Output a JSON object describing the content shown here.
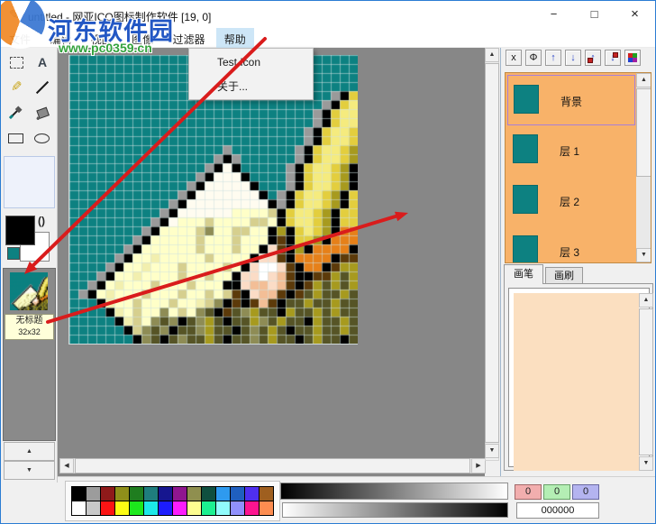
{
  "window": {
    "title": "untitled - 网亚ICO图标制作软件 [19, 0]",
    "controls": {
      "minimize": "−",
      "maximize": "□",
      "close": "×"
    }
  },
  "watermark": {
    "site_name": "河东软件园",
    "site_url": "www.pc0359.cn"
  },
  "menu": {
    "items": [
      {
        "label": "文件"
      },
      {
        "label": "编辑"
      },
      {
        "label": "视图"
      },
      {
        "label": "图像"
      },
      {
        "label": "过滤器"
      },
      {
        "label": "帮助"
      }
    ],
    "dropdown": {
      "items": [
        {
          "label": "Test Icon"
        },
        {
          "label": "关于..."
        }
      ]
    }
  },
  "toolbox": {
    "text_tool_label": "A",
    "swap_label": "()"
  },
  "icon_preview": {
    "name_label": "无标题",
    "size_label": "32x32"
  },
  "layers": {
    "toolbar": [
      {
        "glyph": "x"
      },
      {
        "glyph": "Φ"
      },
      {
        "glyph": "↑"
      },
      {
        "glyph": "↓"
      },
      {
        "glyph": "↑"
      },
      {
        "glyph": "↓"
      },
      {
        "glyph": ""
      }
    ],
    "items": [
      {
        "label": "背景",
        "selected": true
      },
      {
        "label": "层 1"
      },
      {
        "label": "层 2"
      },
      {
        "label": "层 3"
      }
    ],
    "swatch_color": "#0d8181"
  },
  "brush_panel": {
    "tabs": [
      {
        "label": "画笔"
      },
      {
        "label": "画刷"
      }
    ]
  },
  "color_bar": {
    "r": "0",
    "g": "0",
    "b": "0",
    "hex": "000000",
    "palette_row1": [
      "#000000",
      "#9c9c9c",
      "#8f1a1a",
      "#8f8f1a",
      "#1f7d1f",
      "#1f7d7d",
      "#16168f",
      "#8f168f",
      "#8f8f4f",
      "#0f4f3f",
      "#2e9aef",
      "#1f5fbf",
      "#4f2fef",
      "#9f5f1f"
    ],
    "palette_row2": [
      "#ffffff",
      "#c8c8c8",
      "#fc1414",
      "#fcfc14",
      "#1ce81c",
      "#1ce8e8",
      "#1c1cfc",
      "#fc1cfc",
      "#fcfc90",
      "#1cf090",
      "#90fcfc",
      "#9090fc",
      "#fc1490",
      "#fc8c50"
    ]
  },
  "icons": {
    "up": "▲",
    "down": "▼",
    "left": "◀",
    "right": "▶"
  },
  "canvas_art": {
    "grid": 32,
    "cell": 10,
    "background": "#0d8181",
    "grid_line": "rgba(208,226,226,0.55)",
    "palette": {
      "T": "#0d8181",
      "G": "#9a9a9a",
      "K": "#000000",
      "W": "#fffcf0",
      "w": "#ffffc8",
      "y": "#f2efae",
      "s": "#d6cf8e",
      "o": "#8e8c55",
      "O": "#565426",
      "Y": "#e3ce3e",
      "L": "#f5eb7e",
      "M": "#a79a1e",
      "R": "#e68019",
      "B": "#5c3a0a",
      "P": "#f3be96",
      "p": "#fbdcc6",
      "N": "#ffffff"
    },
    "rows": [
      "TTTTTTTTTTTTTTTTTTTTTTTTTTTTTTTT",
      "TTTTTTTTTTTTTTTTTTTTTTTTTTTTTTTT",
      "TTTTTTTTTTTTTTTTTTTTTTTTTTTTTTTT",
      "TTTTTTTTTTTTTTTTTTTTTTTTTTTTTTTT",
      "TTTTTTTTTTTTTTTTTTTTTTTTTTTTTGKY",
      "TTTTTTTTTTTTTTTTTTTTTTTTTTTTGKYL",
      "TTTTTTTTTTTTTTTTTTTTTTTTTTTGKYLL",
      "TTTTTTTTTTTTTTTTTTTTTTTTTTTGKYLL",
      "TTTTTTTTTTTTTTTTTTTTTTTTTTGKYLLY",
      "TTTTTTTTTTTTTTTTTTTTTTTTTTGKYLLY",
      "TTTTTTTTTTTTTTTTTGTTTTTTTGKYLLYM",
      "TTTTTTTTTTTTTTTTGKGTTTTTTGKYLLYM",
      "TTTTTTTTTTTTTTTGKWKTTTTTGKYLLYMK",
      "TTTTTTTTTTTTTTGKWWWKTTTTGKYLLYMK",
      "TTTTTTTTTTTTTGKWWWWWKTTTGKYLLYMK",
      "TTTTTTTTTTTTGKWWWWWWWKTGKYLLYMKY",
      "TTTTTTTTTTTGKWWWWWWWWWKGKYLLYMKY",
      "TTTTTTTTTTGKWWWWWWwwwwsKYLLYMKYY",
      "TTTTTTTTTGKWwwwswwwwsswKYLLYMKYY",
      "TTTTTTTTGKwwwwsowwsswwKMKYLYMKRR",
      "TTTTTTTGKwwwwwswwwswwwKBKYYMKRRR",
      "TTTTTTGKwwwwwwswwwswwKpBKMKRRRRK",
      "TTTTTGKwwywwwwwswwwwKppBKRRRRKBB",
      "TTTTGKwwywwwswwwwswKpNNpBKRRKBMM",
      "TTTGKwwywwwwswwswwKppNpPBKKBBMOM",
      "TTGKwywwwswwwswwwKKpPPpPBKBMOMOM",
      "TGKwywwwswwwswwswsBKpPPBKBOMOOMO",
      "TTTKywwswwwswwysoKBKBPBKOOMOOMOO",
      "TTTTKywswwowswoOKBOoMOOKMOOMOMOO",
      "TTTTTKyswoOoKOoMOKOOMoOMOOKMOOMO",
      "TTTTTTKsoOoKOOoMOOKOoOMOKOOMOOMO",
      "TTTTTTTKoOKOoOOMOKOOoOMOOKOMOOKO"
    ]
  }
}
